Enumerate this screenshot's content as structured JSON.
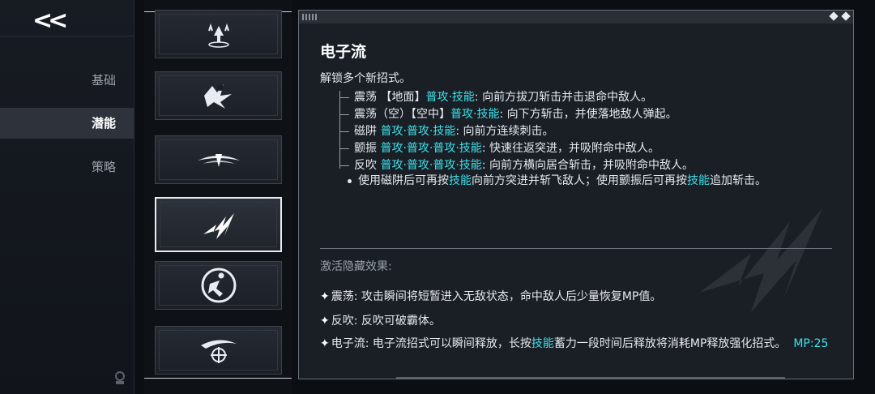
{
  "nav": {
    "back_label": "<<",
    "items": [
      {
        "label": "基础",
        "active": false
      },
      {
        "label": "潜能",
        "active": true
      },
      {
        "label": "策略",
        "active": false
      }
    ]
  },
  "skills": [
    {
      "icon": "leap-icon",
      "selected": false
    },
    {
      "icon": "dash-strike-icon",
      "selected": false
    },
    {
      "icon": "blade-wave-icon",
      "selected": false
    },
    {
      "icon": "electro-current-icon",
      "selected": true
    },
    {
      "icon": "sprint-runner-icon",
      "selected": false
    },
    {
      "icon": "orbit-slash-icon",
      "selected": false
    }
  ],
  "detail": {
    "title": "电子流",
    "intro": "解锁多个新招式。",
    "moves": [
      {
        "name": "震荡 【地面】",
        "combo": "普攻·技能",
        "desc": ": 向前方拔刀斩击并击退命中敌人。"
      },
      {
        "name": "震荡（空）【空中】",
        "combo": "普攻·技能",
        "desc": ": 向下方斩击，并使落地敌人弹起。"
      },
      {
        "name": "磁阱 ",
        "combo": "普攻·普攻·技能",
        "desc": ": 向前方连续刺击。"
      },
      {
        "name": "颤振 ",
        "combo": "普攻·普攻·普攻·技能",
        "desc": ": 快速往返突进，并吸附命中敌人。"
      },
      {
        "name": "反吹 ",
        "combo": "普攻·普攻·普攻·技能",
        "desc": ": 向前方横向居合斩击，并吸附命中敌人。"
      }
    ],
    "note": {
      "p1": "使用磁阱后可再按",
      "k1": "技能",
      "p2": "向前方突进并斩飞敌人；使用颤振后可再按",
      "k2": "技能",
      "p3": "追加斩击。"
    },
    "hidden_label": "激活隐藏效果:",
    "effects": [
      {
        "text": "震荡: 攻击瞬间将短暂进入无敌状态，命中敌人后少量恢复MP值。"
      },
      {
        "text": "反吹: 反吹可破霸体。"
      }
    ],
    "effect3": {
      "p1": "电子流: 电子流招式可以瞬间释放，长按",
      "k1": "技能",
      "p2": "蓄力一段时间后释放将消耗MP释放强化招式。",
      "mp": "MP:25"
    }
  },
  "colors": {
    "accent": "#3ee0ea",
    "panel": "#1a1f26"
  }
}
